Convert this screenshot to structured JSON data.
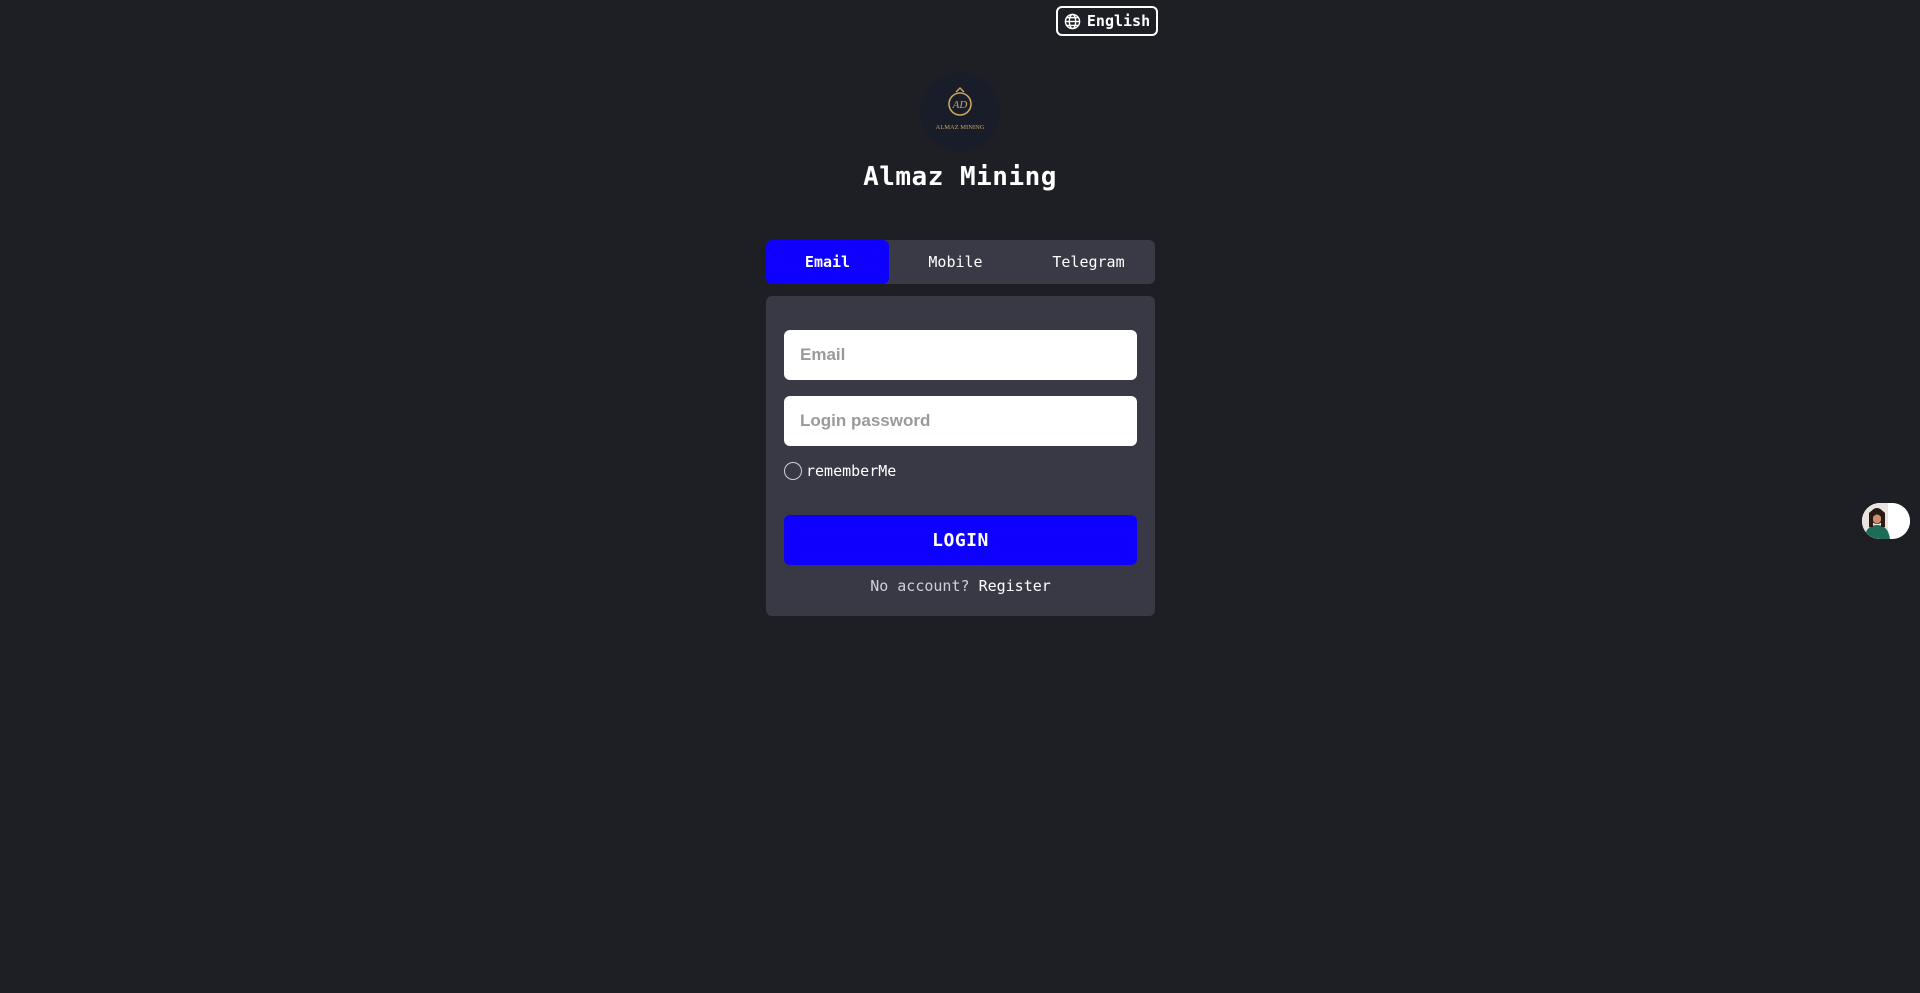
{
  "header": {
    "language_label": "English",
    "language_icon": "globe-icon"
  },
  "brand": {
    "name": "Almaz Mining",
    "logo_text": "ALMAZ MINING",
    "logo_mark": "AD",
    "logo_color": "#c9a55a"
  },
  "tabs": [
    {
      "label": "Email",
      "active": true
    },
    {
      "label": "Mobile",
      "active": false
    },
    {
      "label": "Telegram",
      "active": false
    }
  ],
  "form": {
    "email_placeholder": "Email",
    "email_value": "",
    "password_placeholder": "Login password",
    "password_value": "",
    "remember_label": "rememberMe",
    "remember_checked": false,
    "login_label": "LOGIN",
    "no_account_text": "No account?",
    "register_label": "Register"
  },
  "support": {
    "icon": "customer-support-avatar"
  },
  "colors": {
    "background": "#1e1f25",
    "card": "#393945",
    "accent": "#0d00ff"
  }
}
